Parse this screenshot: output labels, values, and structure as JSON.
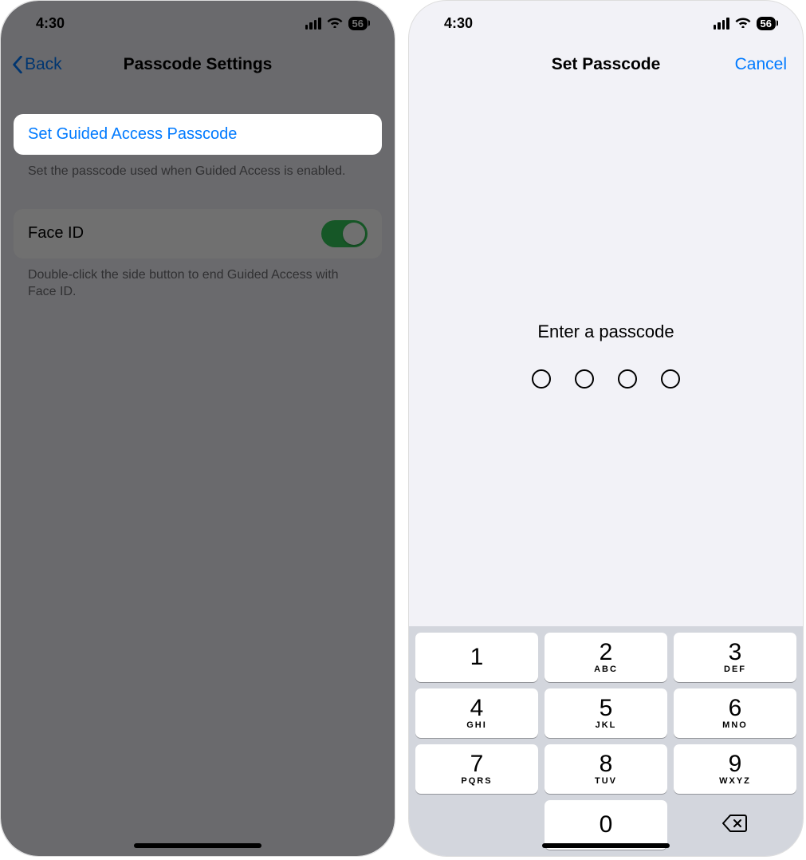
{
  "status": {
    "time": "4:30",
    "battery": "56"
  },
  "left": {
    "back_label": "Back",
    "title": "Passcode Settings",
    "set_passcode_label": "Set Guided Access Passcode",
    "set_passcode_footer": "Set the passcode used when Guided Access is enabled.",
    "faceid_label": "Face ID",
    "faceid_footer": "Double-click the side button to end Guided Access with Face ID."
  },
  "right": {
    "title": "Set Passcode",
    "cancel_label": "Cancel",
    "prompt": "Enter a passcode",
    "keypad": [
      {
        "num": "1",
        "letters": ""
      },
      {
        "num": "2",
        "letters": "ABC"
      },
      {
        "num": "3",
        "letters": "DEF"
      },
      {
        "num": "4",
        "letters": "GHI"
      },
      {
        "num": "5",
        "letters": "JKL"
      },
      {
        "num": "6",
        "letters": "MNO"
      },
      {
        "num": "7",
        "letters": "PQRS"
      },
      {
        "num": "8",
        "letters": "TUV"
      },
      {
        "num": "9",
        "letters": "WXYZ"
      },
      {
        "num": "0",
        "letters": ""
      }
    ]
  }
}
